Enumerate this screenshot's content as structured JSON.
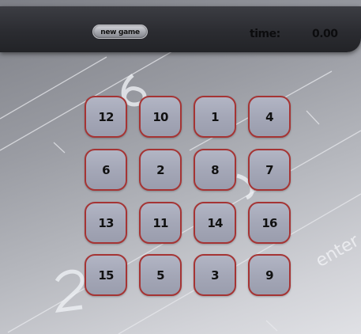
{
  "header": {
    "new_game_label": "new game",
    "time_label": "time:",
    "time_value": "0.00"
  },
  "board": {
    "rows": [
      [
        "12",
        "10",
        "1",
        "4"
      ],
      [
        "6",
        "2",
        "8",
        "7"
      ],
      [
        "13",
        "11",
        "14",
        "16"
      ],
      [
        "15",
        "5",
        "3",
        "9"
      ]
    ]
  },
  "background": {
    "enter_text": "enter"
  },
  "colors": {
    "tile_border": "#a53434",
    "tile_fill": "#a4a7b7",
    "topbar": "#2b2c31"
  }
}
